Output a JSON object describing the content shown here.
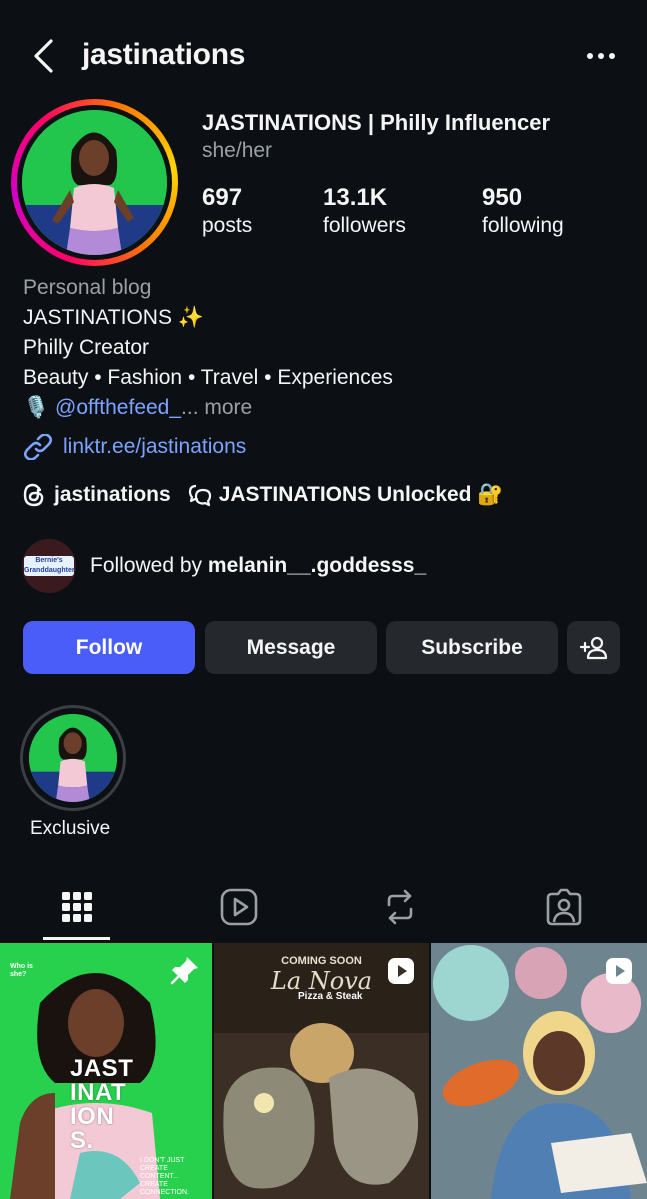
{
  "header": {
    "username": "jastinations"
  },
  "profile": {
    "display_name": "JASTINATIONS | Philly Influencer",
    "pronouns": "she/her",
    "stats": [
      {
        "value": "697",
        "label": "posts"
      },
      {
        "value": "13.1K",
        "label": "followers"
      },
      {
        "value": "950",
        "label": "following"
      }
    ]
  },
  "bio": {
    "category": "Personal blog",
    "line1": "JASTINATIONS ✨",
    "line2": "Philly Creator",
    "line3": "Beauty • Fashion • Travel • Experiences",
    "mention_emoji": "🎙️",
    "mention": "@offthefeed_",
    "ellipsis": "...",
    "more": " more",
    "link": "linktr.ee/jastinations",
    "threads_handle": "jastinations",
    "channel_name": "JASTINATIONS Unlocked 🔐"
  },
  "followed_by": {
    "prefix": "Followed by ",
    "name": "melanin__.goddesss_",
    "badge_text": "Bernie's Granddaughter"
  },
  "actions": {
    "follow": "Follow",
    "message": "Message",
    "subscribe": "Subscribe"
  },
  "highlights": [
    {
      "label": "Exclusive"
    }
  ],
  "tabs": [
    "posts-grid",
    "reels",
    "reposts",
    "tagged"
  ],
  "grid": [
    {
      "kind": "pinned",
      "who_text": "Who is she?",
      "big_text": "JAST\nINAT\nION\nS.",
      "small_text": "I DON'T JUST CREATE CONTENT... CREATE CONNECTION."
    },
    {
      "kind": "reel",
      "coming": "COMING SOON",
      "title": "La Nova",
      "subtitle": "Pizza & Steak"
    },
    {
      "kind": "reel"
    }
  ],
  "colors": {
    "background": "#0c1014",
    "follow_button": "#4a5df9",
    "secondary_button": "#25292e",
    "link": "#7ba3ff",
    "muted": "#9aa0a6"
  }
}
